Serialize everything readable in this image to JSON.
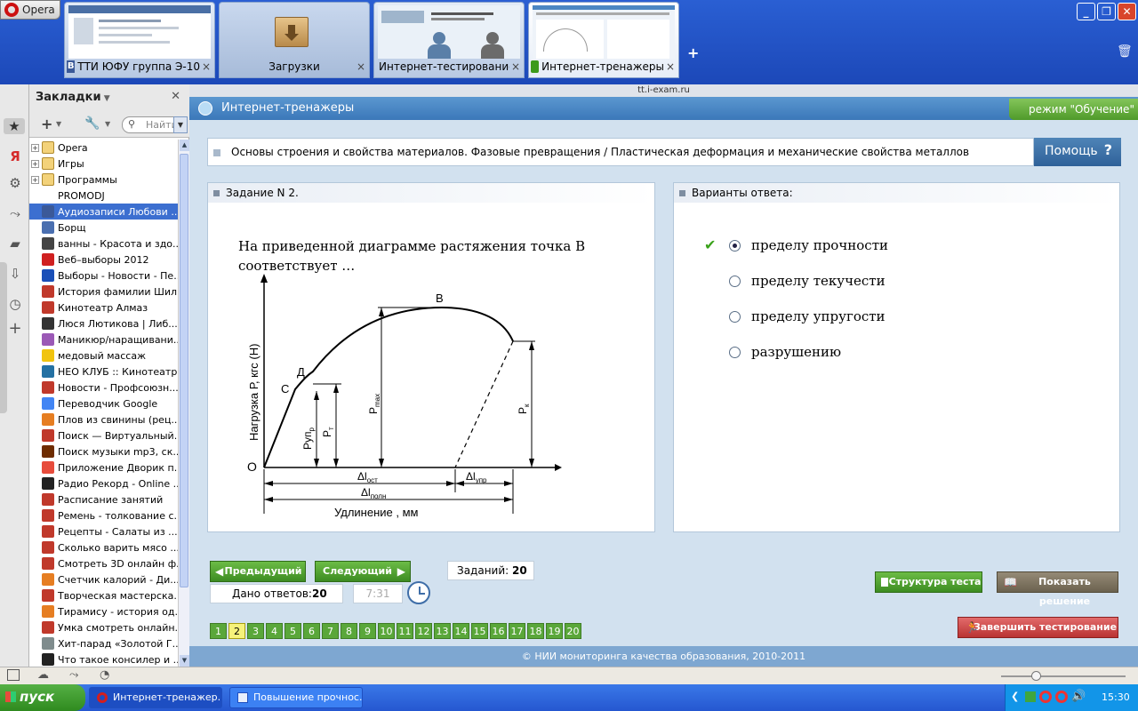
{
  "browser": {
    "opera_label": "Opera",
    "tabs": [
      {
        "label": "ТТИ ЮФУ группа Э-10",
        "favicon": "В"
      },
      {
        "label": "Загрузки"
      },
      {
        "label": "Интернет-тестирование"
      },
      {
        "label": "Интернет-тренажеры"
      }
    ],
    "close_glyph": "×",
    "add_tab": "+",
    "url": "tt.i-exam.ru"
  },
  "sidebar": {
    "title": "Закладки",
    "search_placeholder": "Найти",
    "items": [
      {
        "label": "Opera",
        "folder": true,
        "color": "#f3d27a"
      },
      {
        "label": "Игры",
        "folder": true,
        "color": "#f3d27a"
      },
      {
        "label": "Программы",
        "folder": true,
        "color": "#f3d27a"
      },
      {
        "label": "PROMODJ",
        "color": "#ffffff"
      },
      {
        "label": "Аудиозаписи Любови ...",
        "color": "#3b5998"
      },
      {
        "label": "Борщ",
        "color": "#4a6fb0"
      },
      {
        "label": "ванны - Красота и здо...",
        "color": "#444444"
      },
      {
        "label": "Веб–выборы 2012",
        "color": "#d02020"
      },
      {
        "label": "Выборы - Новости - Пе...",
        "color": "#1a4fb8"
      },
      {
        "label": "История фамилии Шил...",
        "color": "#c0392b"
      },
      {
        "label": "Кинотеатр Алмаз",
        "color": "#c0392b"
      },
      {
        "label": "Люся Лютикова | Либ...",
        "color": "#333333"
      },
      {
        "label": "Маникюр/наращивани...",
        "color": "#9b59b6"
      },
      {
        "label": "медовый массаж",
        "color": "#f1c40f"
      },
      {
        "label": "НЕО КЛУБ :: Кинотеатр",
        "color": "#2471a3"
      },
      {
        "label": "Новости - Профсоюзн...",
        "color": "#c0392b"
      },
      {
        "label": "Переводчик Google",
        "color": "#4285f4"
      },
      {
        "label": "Плов из свинины (рец...",
        "color": "#e67e22"
      },
      {
        "label": "Поиск — Виртуальный...",
        "color": "#c0392b"
      },
      {
        "label": "Поиск музыки mp3, ск...",
        "color": "#6e2c00"
      },
      {
        "label": "Приложение Дворик п...",
        "color": "#e74c3c"
      },
      {
        "label": "Радио Рекорд - Online ...",
        "color": "#222222"
      },
      {
        "label": "Расписание занятий",
        "color": "#c0392b"
      },
      {
        "label": "Ремень - толкование с...",
        "color": "#c0392b"
      },
      {
        "label": "Рецепты - Салаты из ...",
        "color": "#c0392b"
      },
      {
        "label": "Сколько варить мясо ...",
        "color": "#c0392b"
      },
      {
        "label": "Смотреть 3D онлайн ф...",
        "color": "#c0392b"
      },
      {
        "label": "Счетчик калорий - Ди...",
        "color": "#e67e22"
      },
      {
        "label": "Творческая мастерска...",
        "color": "#c0392b"
      },
      {
        "label": "Тирамису - история од...",
        "color": "#e67e22"
      },
      {
        "label": "Умка смотреть онлайн...",
        "color": "#c0392b"
      },
      {
        "label": "Хит-парад «Золотой Г...",
        "color": "#7f8c8d"
      },
      {
        "label": "Что такое консилер и ...",
        "color": "#222222"
      }
    ]
  },
  "site": {
    "title": "Интернет-тренажеры",
    "mode": "режим \"Обучение\"",
    "breadcrumb": "Основы строения и свойства материалов. Фазовые превращения / Пластическая деформация и механические свойства металлов",
    "help": "Помощь",
    "help_icon": "?",
    "task_header": "Задание N 2.",
    "question": "На приведенной диаграмме растяжения точка В соответствует …",
    "answers_header": "Варианты ответа:",
    "answers": [
      {
        "label": "пределу прочности",
        "selected": true
      },
      {
        "label": "пределу текучести",
        "selected": false
      },
      {
        "label": "пределу упругости",
        "selected": false
      },
      {
        "label": "разрушению",
        "selected": false
      }
    ],
    "diagram": {
      "ylabel": "Нагрузка Р, кгс (Н)",
      "xlabel": "Удлинение , мм",
      "point_O": "О",
      "point_C": "С",
      "point_D": "Д",
      "point_B": "В",
      "P_upr": "Руп",
      "P_upr_sub": "р",
      "P_t": "Р",
      "P_t_sub": "т",
      "P_max": "Р",
      "P_max_sub": "max",
      "P_k": "Р",
      "P_k_sub": "к",
      "dl_ost": "Δl",
      "dl_ost_sub": "ост",
      "dl_upr": "Δl",
      "dl_upr_sub": "упр",
      "dl_poln": "Δl",
      "dl_poln_sub": "полн"
    },
    "prev_btn": "Предыдущий",
    "next_btn": "Следующий",
    "tasks_label": "Заданий:",
    "tasks_count": "20",
    "answered_label": "Дано ответов:",
    "answered_count": "20",
    "timer": "7:31",
    "structure_btn": "Структура теста",
    "solution_btn": "Показать решение",
    "finish_btn": "Завершить тестирование",
    "pages": [
      "1",
      "2",
      "3",
      "4",
      "5",
      "6",
      "7",
      "8",
      "9",
      "10",
      "11",
      "12",
      "13",
      "14",
      "15",
      "16",
      "17",
      "18",
      "19",
      "20"
    ],
    "current_page": "2",
    "footer": "© НИИ мониторинга качества образования, 2010-2011"
  },
  "taskbar": {
    "start": "пуск",
    "tasks": [
      "Интернет-тренажер...",
      "Повышение прочнос..."
    ],
    "clock": "15:30"
  }
}
